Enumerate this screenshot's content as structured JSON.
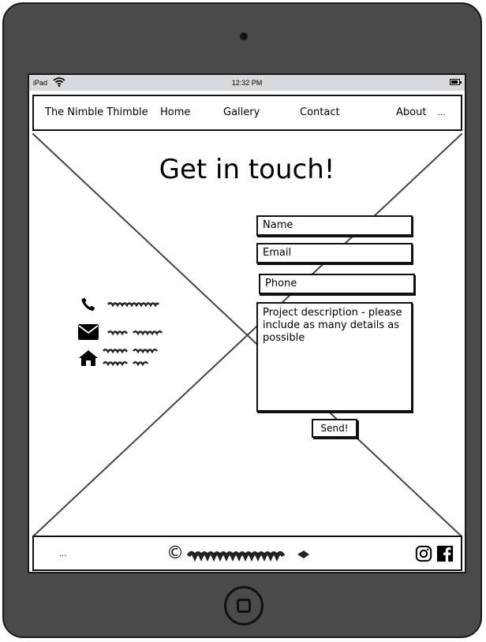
{
  "status_bar": {
    "carrier": "iPad",
    "time": "12:32 PM"
  },
  "nav": {
    "brand": "The Nimble Thimble",
    "items": [
      "Home",
      "Gallery",
      "Contact",
      "About"
    ],
    "more": "..."
  },
  "page": {
    "title": "Get in touch!"
  },
  "form": {
    "name_placeholder": "Name",
    "email_placeholder": "Email",
    "phone_placeholder": "Phone",
    "description_placeholder": "Project description - please include as many details as possible",
    "send_label": "Send!"
  },
  "contact_icons": [
    "phone-icon",
    "envelope-icon",
    "home-icon"
  ],
  "footer": {
    "left_ellipsis": "...",
    "copyright_symbol": "©"
  },
  "social_icons": [
    "instagram-icon",
    "facebook-icon"
  ]
}
